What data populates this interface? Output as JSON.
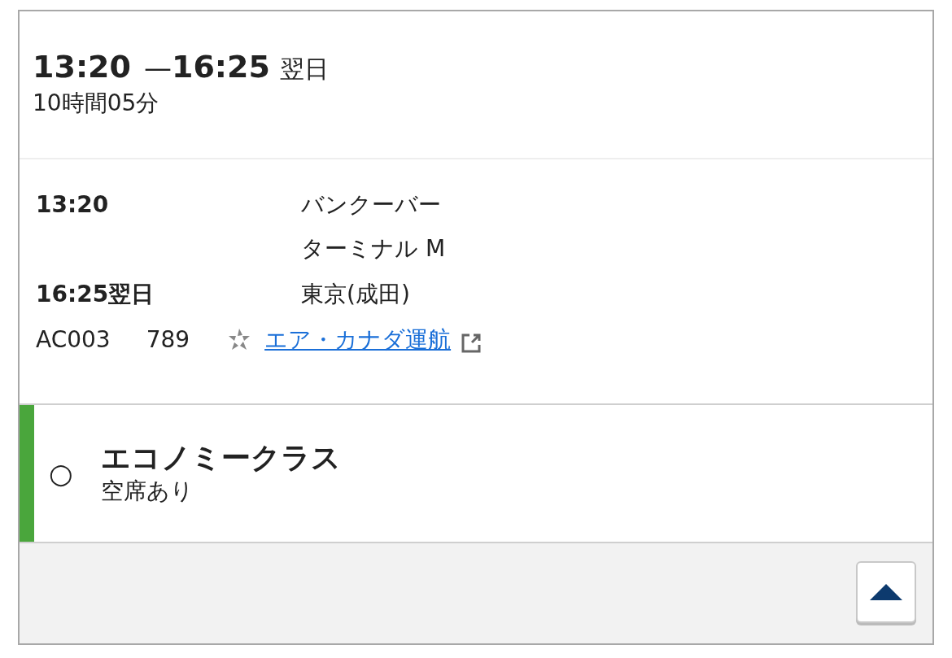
{
  "summary": {
    "depart": "13:20",
    "separator": "—",
    "arrive": "16:25",
    "next_day": "翌日",
    "duration": "10時間05分"
  },
  "segment": {
    "rows": [
      {
        "time": "13:20",
        "place": "バンクーバー",
        "terminal": "ターミナル M"
      },
      {
        "time": "16:25翌日",
        "place": "東京(成田)"
      }
    ],
    "flight": "AC003",
    "aircraft": "789",
    "operator_link": "エア・カナダ運航"
  },
  "fare": {
    "symbol": "○",
    "name": "エコノミークラス",
    "availability": "空席あり",
    "color": "#4aa63c"
  }
}
